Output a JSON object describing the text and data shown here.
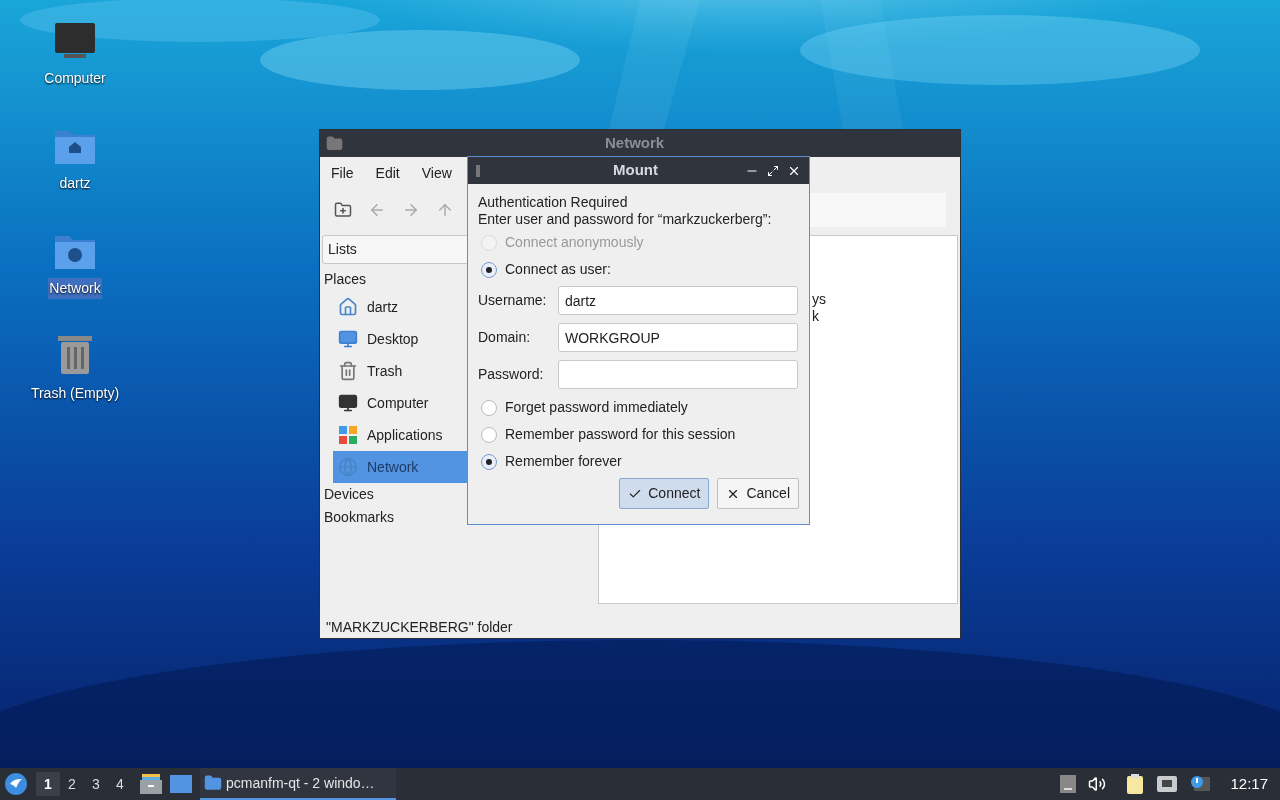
{
  "desktop_icons": [
    {
      "label": "Computer",
      "kind": "computer",
      "selected": false
    },
    {
      "label": "dartz",
      "kind": "home",
      "selected": false
    },
    {
      "label": "Network",
      "kind": "network",
      "selected": true
    },
    {
      "label": "Trash (Empty)",
      "kind": "trash",
      "selected": false
    }
  ],
  "file_manager": {
    "title": "Network",
    "menu": [
      "File",
      "Edit",
      "View"
    ],
    "side_pane_mode": "Lists",
    "sections": [
      {
        "title": "Places",
        "items": [
          {
            "label": "dartz",
            "kind": "home",
            "selected": false
          },
          {
            "label": "Desktop",
            "kind": "desktop",
            "selected": false
          },
          {
            "label": "Trash",
            "kind": "trash",
            "selected": false
          },
          {
            "label": "Computer",
            "kind": "computer",
            "selected": false
          },
          {
            "label": "Applications",
            "kind": "applications",
            "selected": false
          },
          {
            "label": "Network",
            "kind": "network",
            "selected": true
          }
        ]
      },
      {
        "title": "Devices"
      },
      {
        "title": "Bookmarks"
      }
    ],
    "view_fragments": [
      "ys",
      "k"
    ],
    "status_bar": "\"MARKZUCKERBERG\" folder"
  },
  "dialog": {
    "title": "Mount",
    "heading": "Authentication Required",
    "prompt": "Enter user and password for “markzuckerberg”:",
    "connection_options": [
      {
        "label": "Connect anonymously",
        "selected": false,
        "disabled": true
      },
      {
        "label": "Connect as user:",
        "selected": true,
        "disabled": false
      }
    ],
    "fields": [
      {
        "label": "Username:",
        "value": "dartz"
      },
      {
        "label": "Domain:",
        "value": "WORKGROUP"
      },
      {
        "label": "Password:"
      }
    ],
    "password_options": [
      {
        "label": "Forget password immediately",
        "selected": false
      },
      {
        "label": "Remember password for this session",
        "selected": false
      },
      {
        "label": "Remember forever",
        "selected": true
      }
    ],
    "buttons": [
      {
        "label": "Connect",
        "kind": "ok",
        "default": true
      },
      {
        "label": "Cancel",
        "kind": "cancel",
        "default": false
      }
    ]
  },
  "taskbar": {
    "workspaces": [
      {
        "label": "1",
        "selected": true
      },
      {
        "label": "2",
        "selected": false
      },
      {
        "label": "3",
        "selected": false
      },
      {
        "label": "4",
        "selected": false
      }
    ],
    "tasks": [
      {
        "label": "pcmanfm-qt - 2 windo…",
        "active": true
      }
    ],
    "clock": "12:17"
  }
}
